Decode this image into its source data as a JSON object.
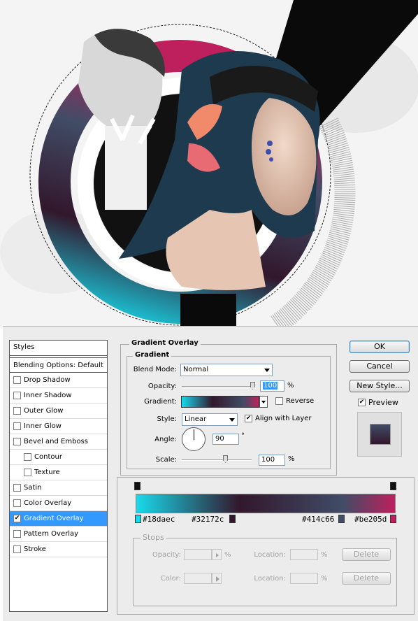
{
  "colors": {
    "cyan": "#18daec",
    "plum": "#32172c",
    "slate": "#414c66",
    "magenta": "#be205d",
    "selection": "#3399ff"
  },
  "styles_panel": {
    "header": "Styles",
    "blending_options": "Blending Options: Default",
    "items": [
      {
        "label": "Drop Shadow",
        "checked": false
      },
      {
        "label": "Inner Shadow",
        "checked": false
      },
      {
        "label": "Outer Glow",
        "checked": false
      },
      {
        "label": "Inner Glow",
        "checked": false
      },
      {
        "label": "Bevel and Emboss",
        "checked": false
      },
      {
        "label": "Contour",
        "checked": false
      },
      {
        "label": "Texture",
        "checked": false
      },
      {
        "label": "Satin",
        "checked": false
      },
      {
        "label": "Color Overlay",
        "checked": false
      },
      {
        "label": "Gradient Overlay",
        "checked": true
      },
      {
        "label": "Pattern Overlay",
        "checked": false
      },
      {
        "label": "Stroke",
        "checked": false
      }
    ]
  },
  "gradient_overlay": {
    "title": "Gradient Overlay",
    "group": "Gradient",
    "blend_mode_label": "Blend Mode:",
    "blend_mode": "Normal",
    "opacity_label": "Opacity:",
    "opacity": "100",
    "opacity_unit": "%",
    "gradient_label": "Gradient:",
    "reverse_label": "Reverse",
    "reverse_checked": false,
    "style_label": "Style:",
    "style": "Linear",
    "align_label": "Align with Layer",
    "align_checked": true,
    "angle_label": "Angle:",
    "angle": "90",
    "angle_unit": "°",
    "scale_label": "Scale:",
    "scale": "100",
    "scale_unit": "%"
  },
  "buttons": {
    "ok": "OK",
    "cancel": "Cancel",
    "new_style": "New Style...",
    "preview": "Preview",
    "preview_checked": true
  },
  "gradient_editor": {
    "stop_labels": [
      "#18daec",
      "#32172c",
      "#414c66",
      "#be205d"
    ],
    "stops_title": "Stops",
    "opacity_label": "Opacity:",
    "opacity_unit": "%",
    "location_label": "Location:",
    "location_unit": "%",
    "color_label": "Color:",
    "delete_label": "Delete"
  }
}
